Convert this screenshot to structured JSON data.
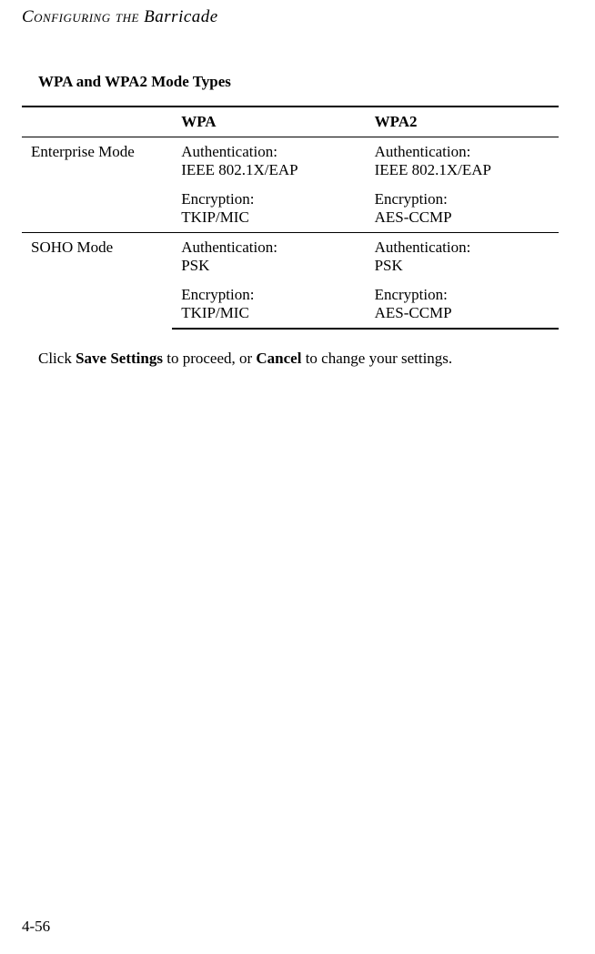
{
  "header": {
    "prefix_smallcaps": "Configuring the ",
    "title": "Barricade"
  },
  "section": {
    "heading": "WPA and WPA2 Mode Types"
  },
  "table": {
    "columns": {
      "mode": "",
      "wpa": "WPA",
      "wpa2": "WPA2"
    },
    "rows": [
      {
        "mode": "Enterprise Mode",
        "wpa_auth_label": "Authentication:",
        "wpa_auth_value": "IEEE 802.1X/EAP",
        "wpa_enc_label": "Encryption:",
        "wpa_enc_value": "TKIP/MIC",
        "wpa2_auth_label": "Authentication:",
        "wpa2_auth_value": "IEEE 802.1X/EAP",
        "wpa2_enc_label": "Encryption:",
        "wpa2_enc_value": "AES-CCMP"
      },
      {
        "mode": "SOHO Mode",
        "wpa_auth_label": "Authentication:",
        "wpa_auth_value": "PSK",
        "wpa_enc_label": "Encryption:",
        "wpa_enc_value": "TKIP/MIC",
        "wpa2_auth_label": "Authentication:",
        "wpa2_auth_value": "PSK",
        "wpa2_enc_label": "Encryption:",
        "wpa2_enc_value": "AES-CCMP"
      }
    ]
  },
  "body": {
    "pre": "Click ",
    "save": "Save Settings",
    "mid": " to proceed, or ",
    "cancel": "Cancel",
    "post": " to change your settings."
  },
  "page_number": "4-56"
}
